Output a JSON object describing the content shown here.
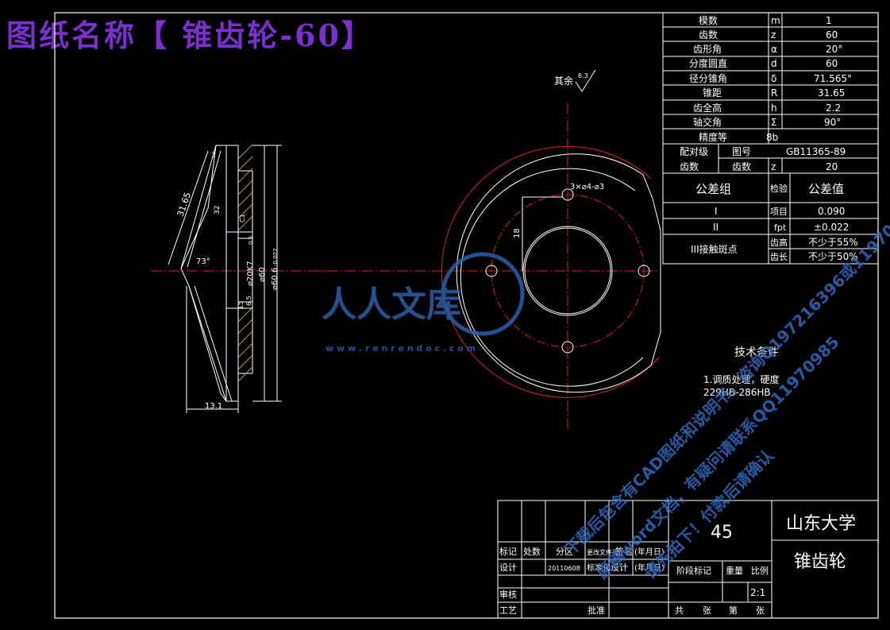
{
  "title": "图纸名称【 锥齿轮-60】",
  "roughness": {
    "label": "其余",
    "value": "6.3"
  },
  "params": [
    {
      "name": "模数",
      "symbol": "m",
      "value": "1"
    },
    {
      "name": "齿数",
      "symbol": "z",
      "value": "60"
    },
    {
      "name": "齿形角",
      "symbol": "α",
      "value": "20°"
    },
    {
      "name": "分度圆直",
      "symbol": "d",
      "value": "60"
    },
    {
      "name": "径分锥角",
      "symbol": "δ",
      "value": "71.565°"
    },
    {
      "name": "锥距",
      "symbol": "R",
      "value": "31.65"
    },
    {
      "name": "齿全高",
      "symbol": "h",
      "value": "2.2"
    },
    {
      "name": "轴交角",
      "symbol": "Σ",
      "value": "90°"
    }
  ],
  "precision": {
    "label": "精度等",
    "value": "8b"
  },
  "mating": {
    "label1": "配对",
    "label2": "齿数",
    "label_top": "配对级",
    "drawing_label": "图号",
    "drawing_value": "GB11365-89",
    "teeth_label": "齿数",
    "teeth_symbol": "z",
    "teeth_value": "20"
  },
  "tolerance": {
    "group_label": "公差组",
    "check_label": "检验",
    "value_label": "公差值",
    "rows": [
      {
        "group": "I",
        "item": "项目",
        "value": "0.090"
      },
      {
        "group": "II",
        "item": "fpt",
        "value": "±0.022"
      }
    ],
    "group3": "III接触斑点",
    "contact": [
      {
        "item": "齿高",
        "value": "不少于55%"
      },
      {
        "item": "齿长",
        "value": "不少于50%"
      }
    ]
  },
  "dimensions": {
    "cone_distance": "31.65",
    "width": "13.1",
    "bore": "⌀20K7",
    "hub": "⌀60",
    "outer": "⌀60.6",
    "tol": "-0.022",
    "angle": "73°",
    "d32": "32",
    "d15": "15",
    "d65": "6.5",
    "d3": "3",
    "d18": "18",
    "holes": "3×⌀4-⌀3",
    "chamfer": "C1",
    "small": "0.5"
  },
  "tech": {
    "heading": "技术条件",
    "line1": "1.调质处理，硬度",
    "line2": "229HB-286HB"
  },
  "watermark": {
    "logo": "人人文库",
    "url": "w w w . r e n r e n d o c . c o m",
    "diag1": "下载后包含有CAD图纸和说明书，咨询Q197216396或11970985",
    "diag2": "原稿word文档，有疑问请联系QQ11970985",
    "diag3": "请先拍下！付款后请确认"
  },
  "titleblock": {
    "material": "45",
    "school": "山东大学",
    "part": "锥齿轮",
    "scale": "2:1",
    "col_labels": [
      "标记",
      "处数",
      "分区",
      "更改文件号",
      "签名",
      "(年月日)"
    ],
    "design_row": [
      "设计",
      "",
      "20110608",
      "标准化",
      "设计",
      "(年月日)"
    ],
    "stage_label": "阶段标记",
    "weight_label": "重量",
    "scale_label": "比例",
    "review": "审核",
    "process": "工艺",
    "approve": "批准",
    "sheet_total": "共",
    "sheet_unit": "张",
    "sheet_no": "第",
    "sheet_unit2": "张"
  }
}
